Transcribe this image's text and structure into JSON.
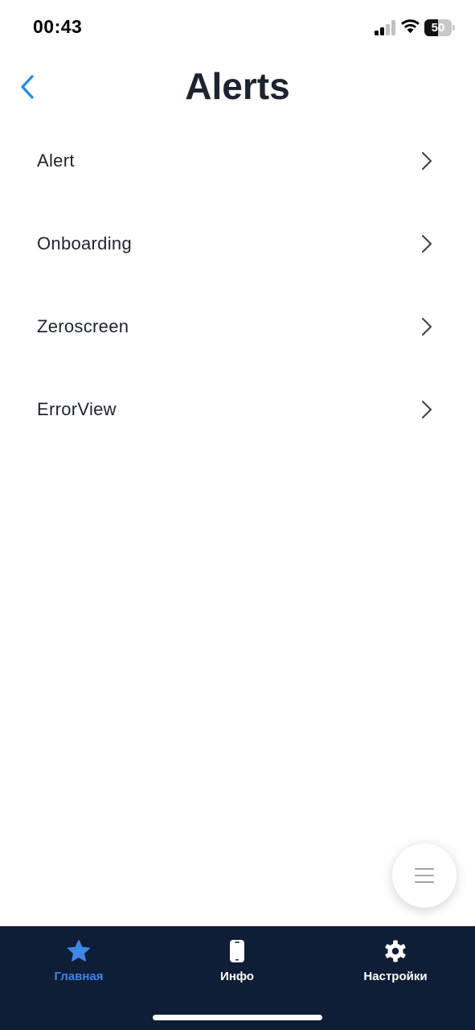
{
  "status_bar": {
    "time": "00:43",
    "battery_level": "50",
    "battery_fraction": 0.5
  },
  "header": {
    "title": "Alerts",
    "back_icon": "chevron-left-icon"
  },
  "menu": {
    "items": [
      {
        "label": "Alert",
        "icon": "chevron-right-icon"
      },
      {
        "label": "Onboarding",
        "icon": "chevron-right-icon"
      },
      {
        "label": "Zeroscreen",
        "icon": "chevron-right-icon"
      },
      {
        "label": "ErrorView",
        "icon": "chevron-right-icon"
      }
    ]
  },
  "fab": {
    "icon": "menu-lines-icon"
  },
  "tab_bar": {
    "tabs": [
      {
        "label": "Главная",
        "icon": "star-icon",
        "active": true
      },
      {
        "label": "Инфо",
        "icon": "phone-icon",
        "active": false
      },
      {
        "label": "Настройки",
        "icon": "gear-icon",
        "active": false
      }
    ]
  },
  "colors": {
    "accent": "#3f86e6",
    "back_arrow": "#2e8be6",
    "title_text": "#1e2330",
    "tab_bar_bg": "#0f1d37",
    "chevron": "#3a3f4a"
  }
}
